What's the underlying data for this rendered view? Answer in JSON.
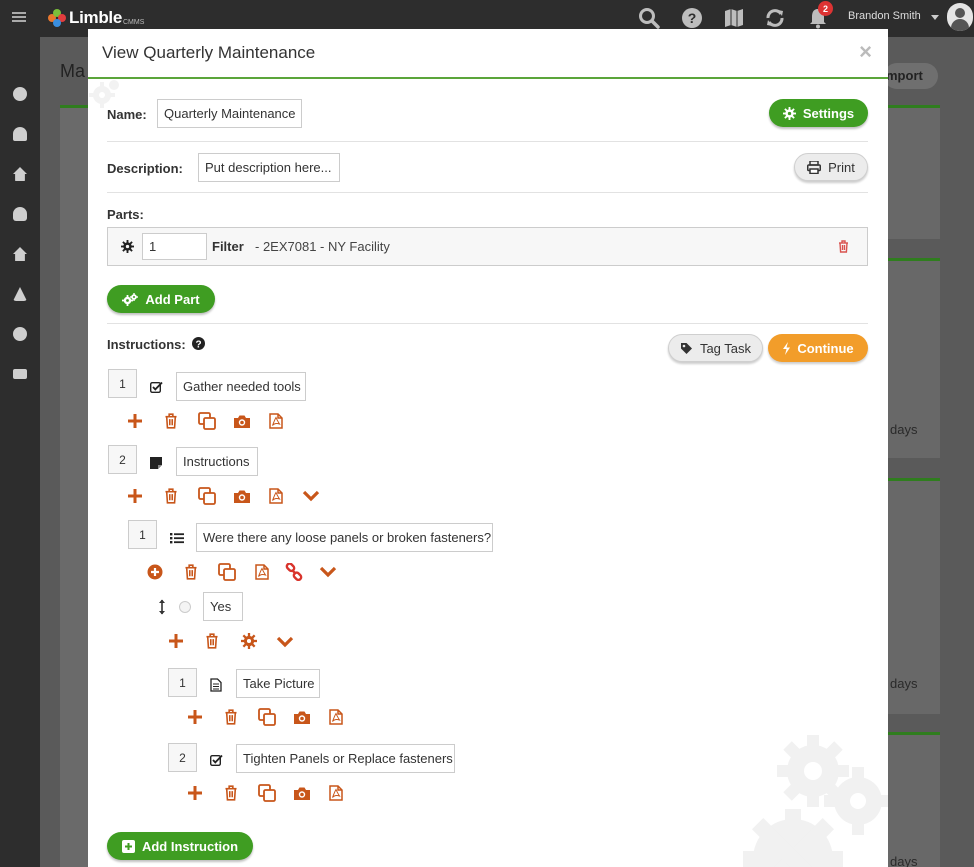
{
  "topbar": {
    "brand": "Limble",
    "brand_sub": "CMMS",
    "notifications_count": "2",
    "user_name": "Brandon Smith"
  },
  "background": {
    "page_title_fragment": "Ma",
    "import_fragment": "mport",
    "days_label": "days"
  },
  "modal": {
    "title": "View Quarterly Maintenance",
    "name_label": "Name:",
    "name_value": "Quarterly Maintenance",
    "settings_label": "Settings",
    "description_label": "Description:",
    "description_placeholder": "Put description here...",
    "print_label": "Print",
    "parts_label": "Parts:",
    "part": {
      "qty": "1",
      "name": "Filter",
      "desc": "- 2EX7081 - NY Facility"
    },
    "add_part_label": "Add Part",
    "instructions_label": "Instructions:",
    "tag_task_label": "Tag Task",
    "continue_label": "Continue",
    "add_instruction_label": "Add Instruction",
    "instructions": [
      {
        "num": "1",
        "type": "checkbox",
        "text": "Gather needed tools"
      },
      {
        "num": "2",
        "type": "note",
        "text": "Instructions"
      },
      {
        "num": "1",
        "type": "dropdown-list",
        "text": "Were there any loose panels or broken fasteners?"
      },
      {
        "option": "Yes"
      },
      {
        "num": "1",
        "type": "file",
        "text": "Take Picture"
      },
      {
        "num": "2",
        "type": "checkbox",
        "text": "Tighten Panels or Replace fasteners"
      }
    ]
  },
  "colors": {
    "accent_green": "#3f9d22",
    "accent_orange": "#f29d2a",
    "action_icon": "#c8561a",
    "delete_red": "#d9534f"
  }
}
